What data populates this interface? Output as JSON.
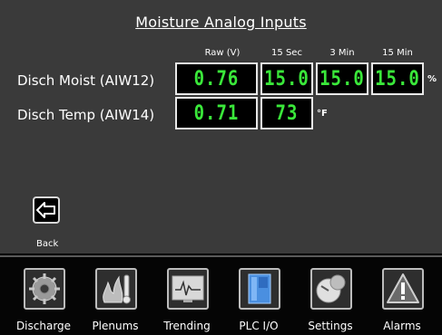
{
  "screen": {
    "title": "Moisture Analog Inputs"
  },
  "columns": [
    "Raw (V)",
    "15 Sec",
    "3 Min",
    "15 Min"
  ],
  "rows": [
    {
      "label": "Disch Moist (AIW12)",
      "values": [
        "0.76",
        "15.0",
        "15.0",
        "15.0"
      ],
      "unit": "%"
    },
    {
      "label": "Disch Temp (AIW14)",
      "values": [
        "0.71",
        "73"
      ],
      "unit": "°F"
    }
  ],
  "back_button": {
    "label": "Back",
    "icon": "arrow-left-icon"
  },
  "navbar": [
    {
      "label": "Discharge",
      "icon": "gear-icon"
    },
    {
      "label": "Plenums",
      "icon": "flame-thermometer-icon"
    },
    {
      "label": "Trending",
      "icon": "trend-monitor-icon"
    },
    {
      "label": "PLC I/O",
      "icon": "plc-rack-icon"
    },
    {
      "label": "Settings",
      "icon": "settings-sphere-icon"
    },
    {
      "label": "Alarms",
      "icon": "warning-triangle-icon"
    }
  ],
  "colors": {
    "readout": "#3ae83a",
    "background": "#3a3a3a",
    "box_border": "#e8e8e8"
  }
}
